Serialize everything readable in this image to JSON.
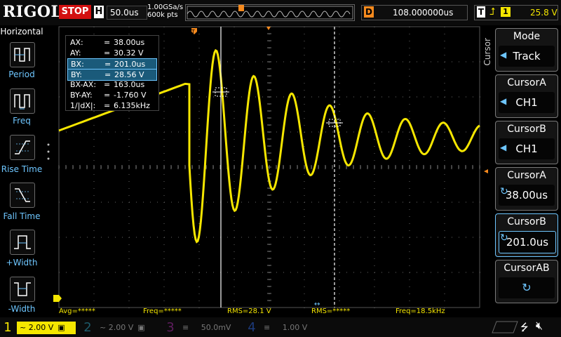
{
  "brand": "RIGOL",
  "run_state": "STOP",
  "timebase": {
    "badge": "H",
    "value": "50.0us",
    "sample_rate": "1.00GSa/s",
    "memory_depth": "600k pts"
  },
  "delay": {
    "badge": "D",
    "value": "108.000000us"
  },
  "trigger": {
    "badge": "T",
    "source": "1",
    "level": "25.8 V"
  },
  "left_panel": {
    "title": "Horizontal",
    "items": [
      "Period",
      "Freq",
      "Rise Time",
      "Fall Time",
      "+Width",
      "-Width"
    ]
  },
  "cursor_readout": {
    "rows": [
      {
        "k": "AX:",
        "v": "38.00us"
      },
      {
        "k": "AY:",
        "v": "30.32 V"
      },
      {
        "k": "BX:",
        "v": "201.0us"
      },
      {
        "k": "BY:",
        "v": "28.56 V"
      },
      {
        "k": "BX-AX:",
        "v": "163.0us"
      },
      {
        "k": "BY-AY:",
        "v": "-1.760 V"
      },
      {
        "k": "1/|dX|:",
        "v": "6.135kHz"
      }
    ]
  },
  "right_menu": {
    "section": "Cursor",
    "items": [
      {
        "title": "Mode",
        "value": "Track"
      },
      {
        "title": "CursorA",
        "value": "CH1"
      },
      {
        "title": "CursorB",
        "value": "CH1"
      },
      {
        "title": "CursorA",
        "value": "38.00us"
      },
      {
        "title": "CursorB",
        "value": "201.0us"
      },
      {
        "title": "CursorAB",
        "value": ""
      }
    ]
  },
  "measurements": [
    "Avg=*****",
    "Freq=*****",
    "RMS=28.1 V",
    "RMS=*****",
    "Freq=18.5kHz"
  ],
  "channels": [
    {
      "num": "1",
      "value": "2.00 V",
      "color": "#f5e600",
      "active": true
    },
    {
      "num": "2",
      "value": "2.00 V",
      "color": "#00a0c8",
      "active": false
    },
    {
      "num": "3",
      "value": "50.0mV",
      "color": "#c030c0",
      "active": false
    },
    {
      "num": "4",
      "value": "1.00 V",
      "color": "#2060ff",
      "active": false
    }
  ],
  "colors": {
    "ch1": "#f5e600",
    "accent": "#f68a1e",
    "menu_text": "#6ec6ff"
  }
}
